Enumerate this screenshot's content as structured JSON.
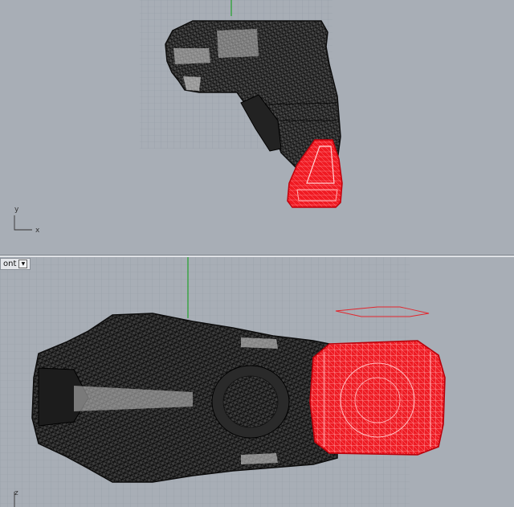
{
  "viewports": {
    "top": {
      "axis_y": "y",
      "axis_x": "x"
    },
    "front": {
      "label": "ont",
      "dropdown_icon": "triangle-down-icon",
      "axis_z": "z"
    }
  },
  "colors": {
    "background": "#a8aeb6",
    "grid_minor": "#959ca5",
    "grid_major": "#7b828b",
    "wireframe": "#111111",
    "selection": "#ee1c24",
    "axis_green": "#1fa02a"
  }
}
